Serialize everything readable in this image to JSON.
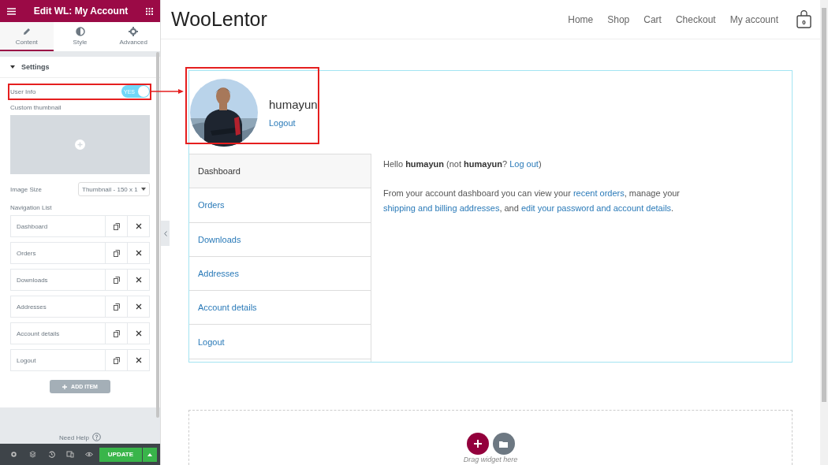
{
  "sidebar": {
    "title": "Edit WL: My Account",
    "tabs": [
      {
        "label": "Content",
        "selected": true
      },
      {
        "label": "Style",
        "selected": false
      },
      {
        "label": "Advanced",
        "selected": false
      }
    ],
    "section": "Settings",
    "user_info": {
      "label": "User Info",
      "on": true,
      "toggle_text": "YES"
    },
    "thumbnail_label": "Custom thumbnail",
    "image_size": {
      "label": "Image Size",
      "value": "Thumbnail - 150 x 1"
    },
    "nav_label": "Navigation List",
    "nav_items": [
      "Dashboard",
      "Orders",
      "Downloads",
      "Addresses",
      "Account details",
      "Logout"
    ],
    "add_button": "ADD ITEM",
    "help": "Need Help",
    "update_button": "UPDATE"
  },
  "site": {
    "logo": "WooLentor",
    "menu": [
      "Home",
      "Shop",
      "Cart",
      "Checkout",
      "My account"
    ],
    "cart_count": "0"
  },
  "account": {
    "user_name": "humayun",
    "logout": "Logout",
    "nav": [
      {
        "label": "Dashboard",
        "selected": true
      },
      {
        "label": "Orders",
        "selected": false
      },
      {
        "label": "Downloads",
        "selected": false
      },
      {
        "label": "Addresses",
        "selected": false
      },
      {
        "label": "Account details",
        "selected": false
      },
      {
        "label": "Logout",
        "selected": false
      }
    ],
    "greeting": [
      {
        "text": "Hello **humayun** (not **humayun**? ",
        "link": false
      },
      {
        "text": "Log out",
        "link": true
      },
      {
        "text": ")",
        "link": false
      }
    ],
    "intro": [
      {
        "text": "From your account dashboard you can view your ",
        "link": false
      },
      {
        "text": "recent orders",
        "link": true
      },
      {
        "text": ", manage your ",
        "link": false
      },
      {
        "text": "shipping and billing addresses",
        "link": true
      },
      {
        "text": ", and ",
        "link": false
      },
      {
        "text": "edit your password and account details",
        "link": true
      },
      {
        "text": ".",
        "link": false
      }
    ]
  },
  "drop_zone": {
    "hint": "Drag widget here"
  }
}
